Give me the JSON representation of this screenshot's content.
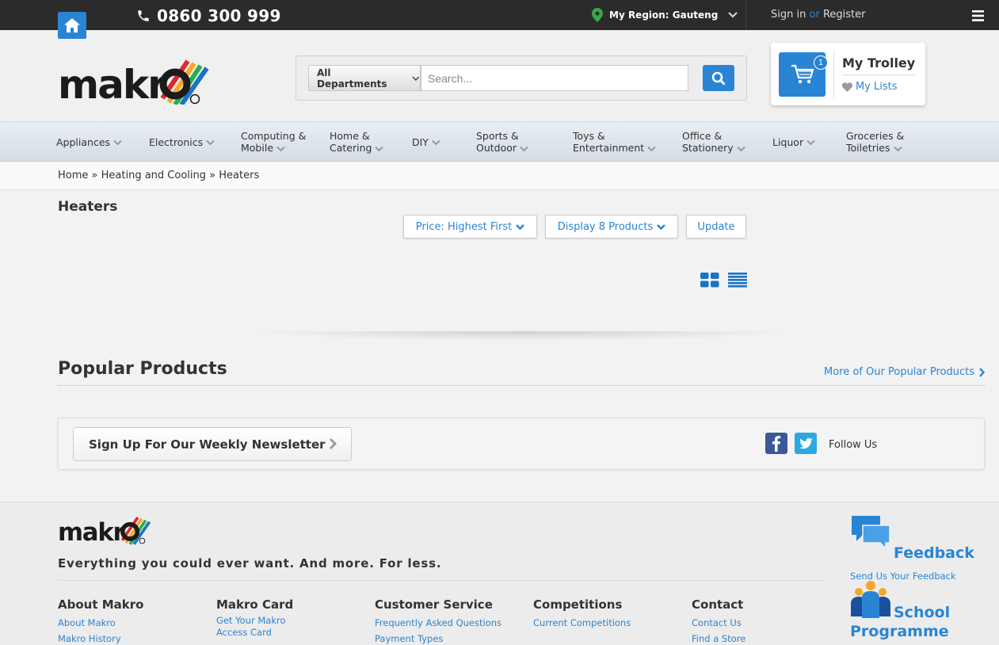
{
  "topbar": {
    "phone": "0860 300 999",
    "region": "My Region: Gauteng",
    "sign_in": "Sign in",
    "or": "or",
    "register": "Register"
  },
  "search": {
    "department": "All Departments",
    "placeholder": "Search..."
  },
  "trolley": {
    "count": "1",
    "title": "My Trolley",
    "lists": "My Lists"
  },
  "nav": {
    "items": [
      {
        "l1": "Appliances",
        "l2": ""
      },
      {
        "l1": "Electronics",
        "l2": ""
      },
      {
        "l1": "Computing &",
        "l2": "Mobile"
      },
      {
        "l1": "Home &",
        "l2": "Catering"
      },
      {
        "l1": "DIY",
        "l2": ""
      },
      {
        "l1": "Sports &",
        "l2": "Outdoor"
      },
      {
        "l1": "Toys &",
        "l2": "Entertainment"
      },
      {
        "l1": "Office &",
        "l2": "Stationery"
      },
      {
        "l1": "Liquor",
        "l2": ""
      },
      {
        "l1": "Groceries &",
        "l2": "Toiletries"
      }
    ]
  },
  "breadcrumb": {
    "home": "Home",
    "sep": "»",
    "cat": "Heating and Cooling",
    "current": "Heaters"
  },
  "listing": {
    "title": "Heaters",
    "sort": "Price: Highest First",
    "display": "Display 8 Products",
    "update": "Update"
  },
  "popular": {
    "title": "Popular Products",
    "more": "More of Our Popular Products"
  },
  "newsletter": {
    "label": "Sign Up For Our Weekly Newsletter",
    "follow": "Follow Us"
  },
  "footer": {
    "tagline": "Everything you could ever want. And more. For less.",
    "cols": [
      {
        "title": "About Makro",
        "links": [
          "About Makro",
          "Makro History"
        ]
      },
      {
        "title": "Makro Card",
        "links": [
          "Get Your Makro Access Card"
        ]
      },
      {
        "title": "Customer Service",
        "links": [
          "Frequently Asked Questions",
          "Payment Types"
        ]
      },
      {
        "title": "Competitions",
        "links": [
          "Current Competitions"
        ]
      },
      {
        "title": "Contact",
        "links": [
          "Contact Us",
          "Find a Store"
        ]
      }
    ],
    "feedback": "Feedback",
    "feedback_sub": "Send Us Your Feedback",
    "school_1": "School",
    "school_2": "Programme"
  },
  "colors": {
    "accent": "#2a84d4",
    "topbar": "#2b2b2b",
    "pin": "#3aa64a"
  }
}
